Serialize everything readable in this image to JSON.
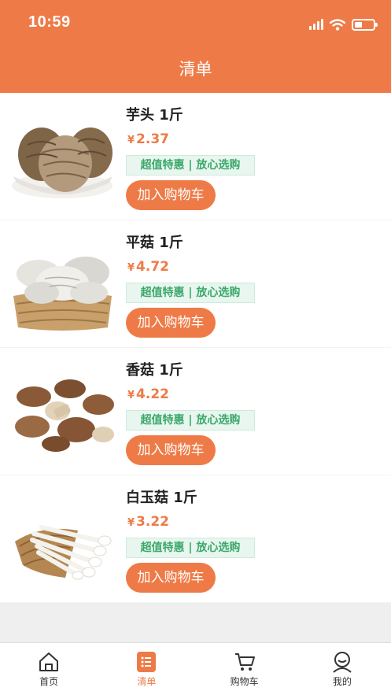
{
  "status_bar": {
    "time": "10:59"
  },
  "header": {
    "title": "清单"
  },
  "items": [
    {
      "name": "芋头 1斤",
      "currency": "¥",
      "price": "2.37",
      "tag": "超值特惠 | 放心选购",
      "button": "加入购物车",
      "image": "taro"
    },
    {
      "name": "平菇 1斤",
      "currency": "¥",
      "price": "4.72",
      "tag": "超值特惠 | 放心选购",
      "button": "加入购物车",
      "image": "oyster-mushroom"
    },
    {
      "name": "香菇 1斤",
      "currency": "¥",
      "price": "4.22",
      "tag": "超值特惠 | 放心选购",
      "button": "加入购物车",
      "image": "shiitake"
    },
    {
      "name": "白玉菇 1斤",
      "currency": "¥",
      "price": "3.22",
      "tag": "超值特惠 | 放心选购",
      "button": "加入购物车",
      "image": "white-beech-mushroom"
    }
  ],
  "tabbar": [
    {
      "label": "首页",
      "icon": "home-icon",
      "active": false
    },
    {
      "label": "清单",
      "icon": "list-icon",
      "active": true
    },
    {
      "label": "购物车",
      "icon": "cart-icon",
      "active": false
    },
    {
      "label": "我的",
      "icon": "user-icon",
      "active": false
    }
  ],
  "colors": {
    "accent": "#ee7b47",
    "tag_text": "#3aa86a",
    "tag_bg": "#e8f6ef",
    "background": "#efefef"
  }
}
